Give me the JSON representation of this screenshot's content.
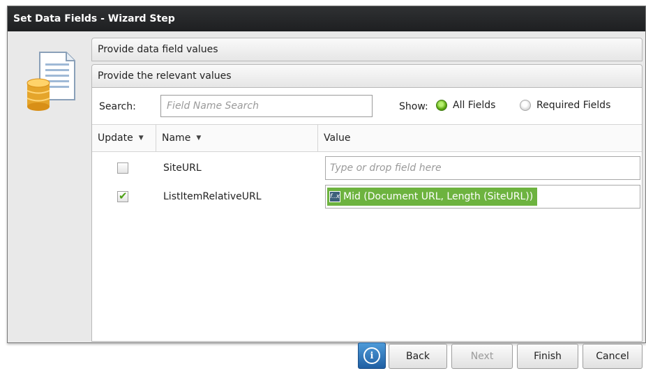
{
  "window": {
    "title": "Set Data Fields - Wizard Step"
  },
  "sections": {
    "data_field_values": "Provide data field values",
    "relevant_values": "Provide the relevant values"
  },
  "search": {
    "label": "Search:",
    "placeholder": "Field Name Search"
  },
  "show": {
    "label": "Show:",
    "options": [
      {
        "label": "All Fields",
        "selected": true
      },
      {
        "label": "Required Fields",
        "selected": false
      }
    ]
  },
  "table": {
    "columns": {
      "update": "Update",
      "name": "Name",
      "value": "Value"
    },
    "rows": [
      {
        "checked": false,
        "name": "SiteURL",
        "value_placeholder": "Type or drop field here",
        "value": ""
      },
      {
        "checked": true,
        "name": "ListItemRelativeURL",
        "value_placeholder": "",
        "value": "Mid (Document URL, Length (SiteURL))"
      }
    ]
  },
  "buttons": {
    "info": "i",
    "back": "Back",
    "next": "Next",
    "finish": "Finish",
    "cancel": "Cancel"
  },
  "icons": {
    "side": "document-database-icon",
    "info": "info-icon",
    "token": "function-icon",
    "check": "checkmark-icon"
  },
  "colors": {
    "titlebar": "#262829",
    "accent_green": "#6db33f",
    "info_blue": "#2a6fb7"
  }
}
